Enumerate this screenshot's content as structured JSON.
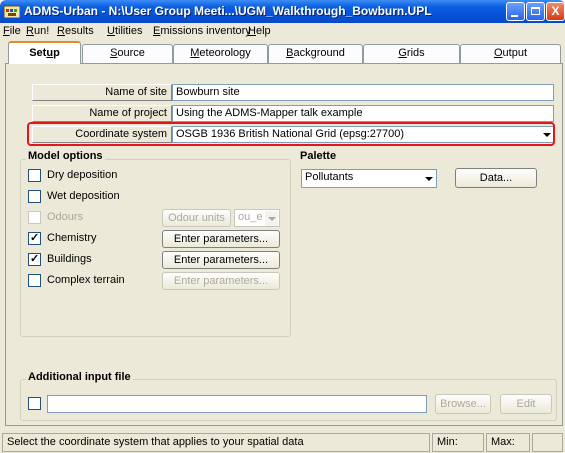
{
  "window": {
    "title": "ADMS-Urban - N:\\User Group Meeti...\\UGM_Walkthrough_Bowburn.UPL",
    "close_glyph": "X"
  },
  "menu": [
    {
      "label": "File",
      "hotkey": "F",
      "rest": "ile"
    },
    {
      "label": "Run!",
      "hotkey": "R",
      "rest": "un!"
    },
    {
      "label": "Results",
      "hotkey": "R",
      "rest": "esults"
    },
    {
      "label": "Utilities",
      "hotkey": "U",
      "rest": "tilities"
    },
    {
      "label": "Emissions inventory",
      "hotkey": "E",
      "rest": "missions inventory"
    },
    {
      "label": "Help",
      "hotkey": "H",
      "rest": "elp"
    }
  ],
  "tabs": [
    {
      "label": "Setup",
      "pre": "Set",
      "hotkey": "u",
      "post": "p",
      "active": true
    },
    {
      "label": "Source",
      "pre": "",
      "hotkey": "S",
      "post": "ource"
    },
    {
      "label": "Meteorology",
      "pre": "",
      "hotkey": "M",
      "post": "eteorology"
    },
    {
      "label": "Background",
      "pre": "",
      "hotkey": "B",
      "post": "ackground"
    },
    {
      "label": "Grids",
      "pre": "",
      "hotkey": "G",
      "post": "rids"
    },
    {
      "label": "Output",
      "pre": "",
      "hotkey": "O",
      "post": "utput"
    }
  ],
  "fields": {
    "site_name": {
      "label": "Name of site",
      "value": "Bowburn site"
    },
    "project_name": {
      "label": "Name of project",
      "value": "Using the ADMS-Mapper talk example"
    },
    "coordinate_system": {
      "label": "Coordinate system",
      "value": "OSGB 1936 British National Grid (epsg:27700)"
    }
  },
  "highlight_color": "#e8141c",
  "model_options": {
    "title": "Model options",
    "dry_deposition": {
      "label": "Dry deposition",
      "checked": false
    },
    "wet_deposition": {
      "label": "Wet deposition",
      "checked": false
    },
    "odours": {
      "label": "Odours",
      "checked": false,
      "enabled": false
    },
    "odour_units_label": "Odour units",
    "odour_units_value": "ou_e",
    "chemistry": {
      "label": "Chemistry",
      "checked": true
    },
    "buildings": {
      "label": "Buildings",
      "checked": true
    },
    "complex_terrain": {
      "label": "Complex terrain",
      "checked": false
    },
    "enter_parameters_label": "Enter parameters...",
    "check_mark": "✓"
  },
  "palette": {
    "title": "Palette",
    "selected": "Pollutants",
    "data_button": "Data..."
  },
  "additional_input": {
    "title": "Additional input file",
    "path": "",
    "browse_button": "Browse...",
    "edit_button": "Edit"
  },
  "status": {
    "message": "Select the coordinate system that applies to your spatial data",
    "min_label": "Min:",
    "max_label": "Max:"
  }
}
